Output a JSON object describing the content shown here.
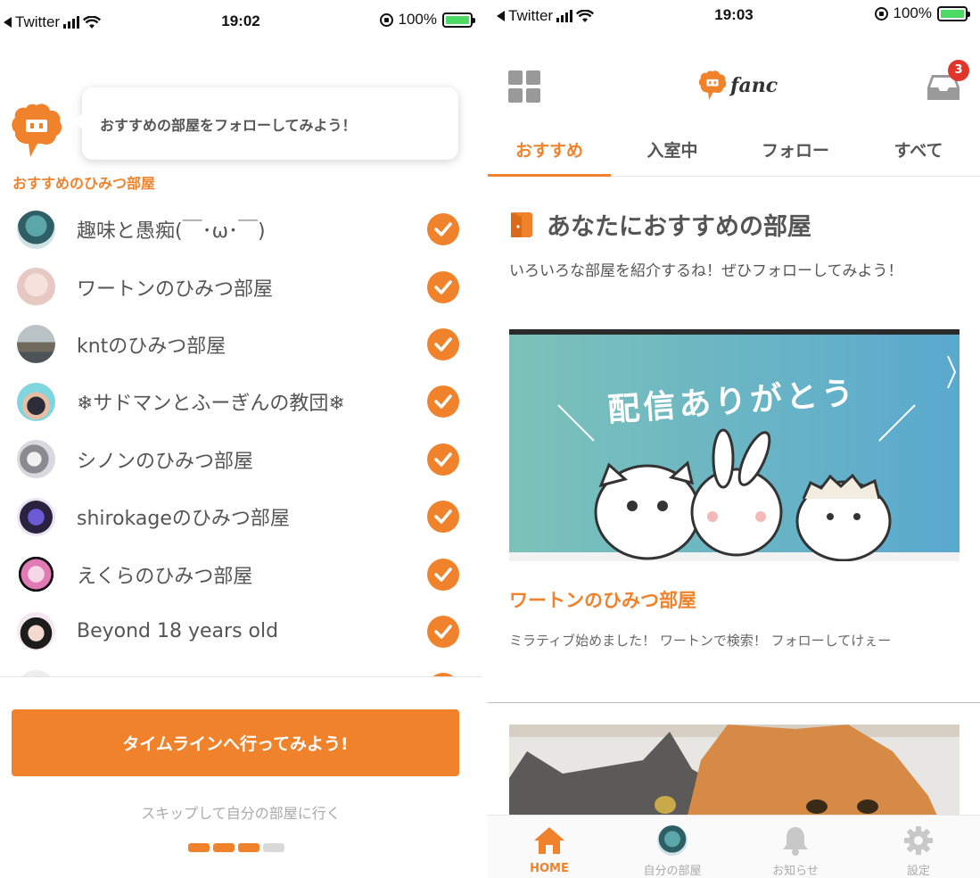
{
  "left": {
    "status": {
      "back_app": "Twitter",
      "time": "19:02",
      "battery": "100%"
    },
    "bubble_text": "おすすめの部屋をフォローしてみよう！",
    "section_label": "おすすめのひみつ部屋",
    "rooms": [
      {
        "name": "趣味と愚痴(￣･ω･￣)",
        "followed": true
      },
      {
        "name": "ワートンのひみつ部屋",
        "followed": true
      },
      {
        "name": "kntのひみつ部屋",
        "followed": true
      },
      {
        "name": "❄サドマンとふーぎんの教団❄",
        "followed": true
      },
      {
        "name": "シノンのひみつ部屋",
        "followed": true
      },
      {
        "name": "shirokageのひみつ部屋",
        "followed": true
      },
      {
        "name": "えくらのひみつ部屋",
        "followed": true
      },
      {
        "name": "Beyond 18 years old",
        "followed": true
      }
    ],
    "cta_label": "タイムラインへ行ってみよう!",
    "skip_label": "スキップして自分の部屋に行く",
    "progress": {
      "current": 3,
      "total": 4
    }
  },
  "right": {
    "status": {
      "back_app": "Twitter",
      "time": "19:03",
      "battery": "100%"
    },
    "logo_text": "fanc",
    "inbox_badge": "3",
    "tabs": [
      {
        "label": "おすすめ",
        "active": true
      },
      {
        "label": "入室中",
        "active": false
      },
      {
        "label": "フォロー",
        "active": false
      },
      {
        "label": "すべて",
        "active": false
      }
    ],
    "section_title": "あなたにおすすめの部屋",
    "section_desc": "いろいろな部屋を紹介するね！ぜひフォローしてみよう！",
    "banner_text": "配信ありがとう",
    "card_title": "ワートンのひみつ部屋",
    "card_desc": "ミラティブ始めました！ ワートンで検索！ フォローしてけぇー",
    "nav": [
      {
        "label": "HOME",
        "icon": "home-icon",
        "active": true
      },
      {
        "label": "自分の部屋",
        "icon": "avatar-icon",
        "active": false
      },
      {
        "label": "お知らせ",
        "icon": "bell-icon",
        "active": false
      },
      {
        "label": "設定",
        "icon": "gear-icon",
        "active": false
      }
    ]
  },
  "colors": {
    "accent": "#f0822b",
    "badge": "#e0352b",
    "text": "#555555",
    "muted": "#aaaaaa"
  }
}
